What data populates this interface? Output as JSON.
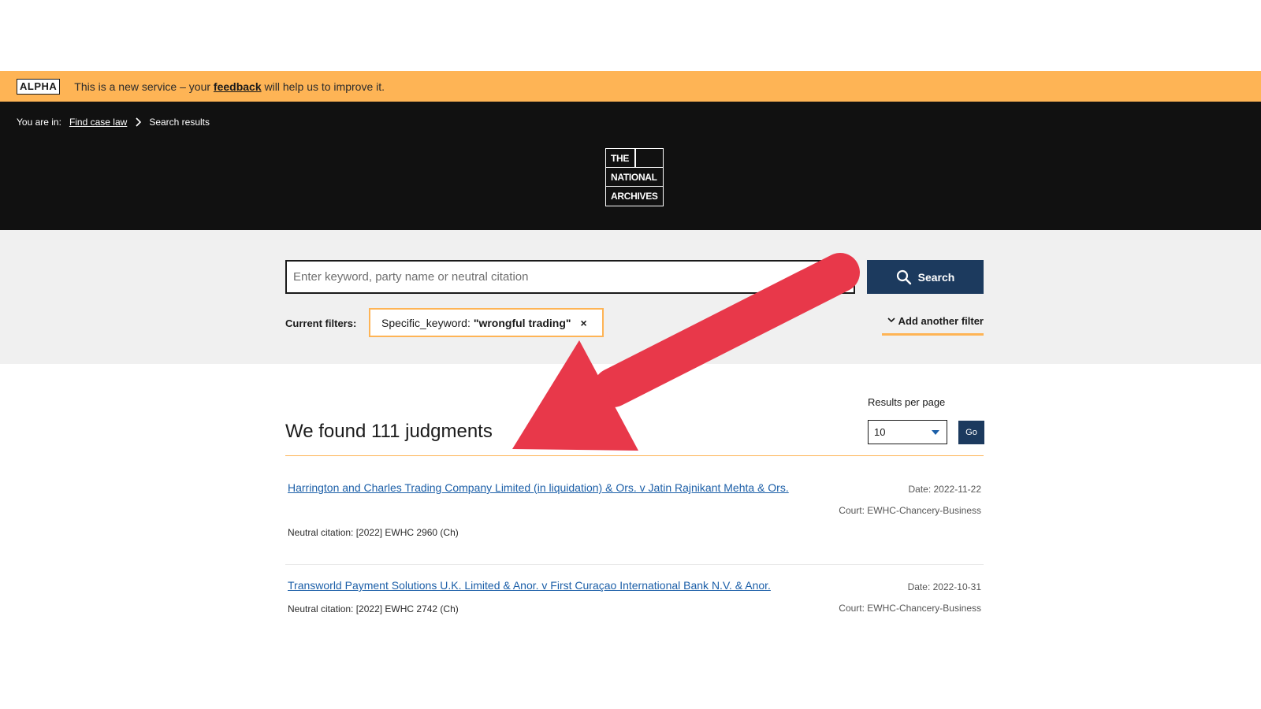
{
  "banner": {
    "tag": "ALPHA",
    "text_before": "This is a new service – your",
    "link": "feedback",
    "text_after": "will help us to improve it."
  },
  "breadcrumb": {
    "prefix": "You are in:",
    "link": "Find case law",
    "current": "Search results"
  },
  "logo": {
    "line1": "THE",
    "line2": "NATIONAL",
    "line3": "ARCHIVES"
  },
  "search": {
    "placeholder": "Enter keyword, party name or neutral citation",
    "value": "",
    "button_label": "Search"
  },
  "filters": {
    "label": "Current filters:",
    "active": [
      {
        "key": "Specific_keyword:",
        "value": "\"wrongful trading\"",
        "remove": "×"
      }
    ],
    "add_label": "Add another filter"
  },
  "results": {
    "heading": "We found 111 judgments",
    "per_page_label": "Results per page",
    "per_page_value": "10",
    "go_label": "Go",
    "items": [
      {
        "title": "Harrington and Charles Trading Company Limited (in liquidation) & Ors. v Jatin Rajnikant Mehta & Ors.",
        "citation": "Neutral citation: [2022] EWHC 2960 (Ch)",
        "date": "Date: 2022-11-22",
        "court": "Court: EWHC-Chancery-Business"
      },
      {
        "title": "Transworld Payment Solutions U.K. Limited & Anor. v First Curaçao International Bank N.V. & Anor.",
        "citation": "Neutral citation: [2022] EWHC 2742 (Ch)",
        "date": "Date: 2022-10-31",
        "court": "Court: EWHC-Chancery-Business"
      }
    ]
  },
  "colors": {
    "banner": "#feb455",
    "header": "#111111",
    "search_bg": "#f0f0f0",
    "button": "#1c3a5e",
    "link": "#1c5fa8",
    "annotation_arrow": "#e8384a"
  }
}
